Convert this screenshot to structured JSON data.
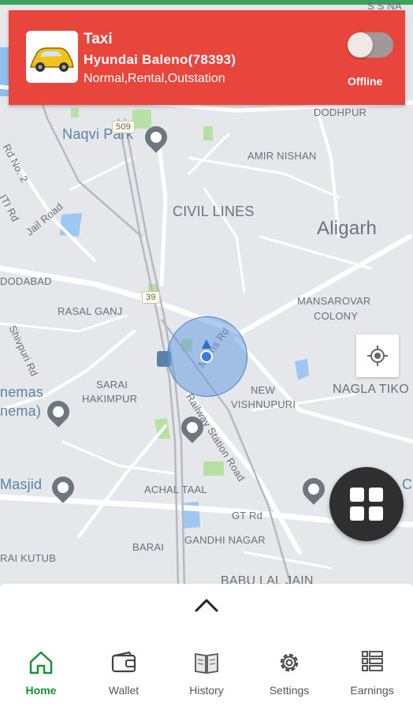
{
  "vehicle": {
    "type": "Taxi",
    "model": "Hyundai Baleno(78393)",
    "services": "Normal,Rental,Outstation",
    "status": "Offline",
    "online": false
  },
  "map": {
    "labels": {
      "sshah": "S S NA",
      "dodhpur": "DODHPUR",
      "naqvi_park": "Naqvi Park",
      "shield_509": "509",
      "amir_nishan": "AMIR NISHAN",
      "rd_no2": "Rd No. 2",
      "iti_rd": "ITI Rd",
      "jail_road": "Jail Road",
      "civil_lines": "CIVIL LINES",
      "aligarh": "Aligarh",
      "doodabad": "DODABAD",
      "shield_39": "39",
      "mansarovar": "MANSAROVAR",
      "colony": "COLONY",
      "rasal_ganj": "RASAL GANJ",
      "shivpuri_rd": "Shivpuri Rd",
      "marris_rd": "Marris Rd",
      "sarai": "SARAI",
      "hakimpur": "HAKIMPUR",
      "nemas": "nemas",
      "nema": "nema)",
      "new": "NEW",
      "vishnupuri": "VISHNUPURI",
      "nagla_tiko": "NAGLA TIKO",
      "railway_station_road": "Railway Station Road",
      "masjid": "Masjid",
      "achal_taal": "ACHAL TAAL",
      "gt_rd": "GT Rd",
      "barai": "BARAI",
      "gandhi_nagar": "GANDHI NAGAR",
      "rai_kutub": "RAI KUTUB",
      "babu_lal_jain": "BABU LAL JAIN",
      "c_edge": "C"
    }
  },
  "nav": {
    "items": [
      {
        "label": "Home",
        "icon": "home-icon",
        "active": true
      },
      {
        "label": "Wallet",
        "icon": "wallet-icon",
        "active": false
      },
      {
        "label": "History",
        "icon": "book-icon",
        "active": false
      },
      {
        "label": "Settings",
        "icon": "gear-icon",
        "active": false
      },
      {
        "label": "Earnings",
        "icon": "list-icon",
        "active": false
      }
    ]
  },
  "colors": {
    "header": "#e8453c",
    "active_nav": "#1a8f3a",
    "location": "#3a7ee0"
  }
}
